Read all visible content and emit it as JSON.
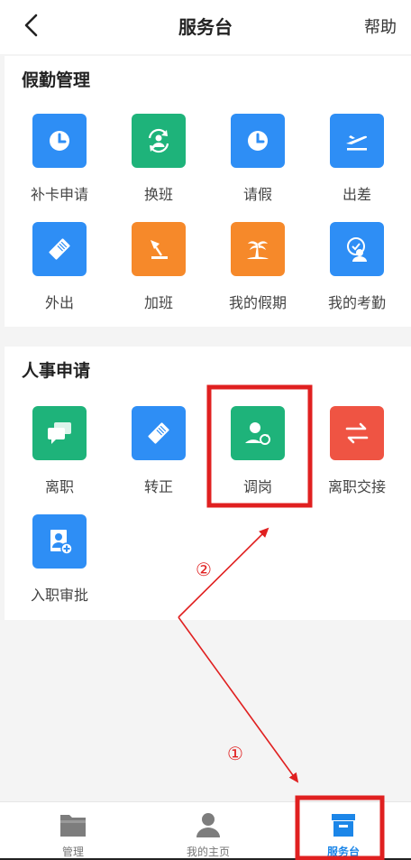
{
  "header": {
    "title": "服务台",
    "help_label": "帮助"
  },
  "leave_section": {
    "title": "假勤管理",
    "items": [
      {
        "label": "补卡申请",
        "icon": "clock-icon",
        "color": "#2e8ef5"
      },
      {
        "label": "换班",
        "icon": "swap-shift-icon",
        "color": "#1eb37a"
      },
      {
        "label": "请假",
        "icon": "clock-icon",
        "color": "#2e8ef5"
      },
      {
        "label": "出差",
        "icon": "airplane-icon",
        "color": "#2e8ef5"
      },
      {
        "label": "外出",
        "icon": "eraser-icon",
        "color": "#2e8ef5"
      },
      {
        "label": "加班",
        "icon": "desk-lamp-icon",
        "color": "#f6892a"
      },
      {
        "label": "我的假期",
        "icon": "palm-tree-icon",
        "color": "#f6892a"
      },
      {
        "label": "我的考勤",
        "icon": "user-check-icon",
        "color": "#2e8ef5"
      }
    ]
  },
  "hr_section": {
    "title": "人事申请",
    "items": [
      {
        "label": "离职",
        "icon": "chat-bubbles-icon",
        "color": "#1eb37a"
      },
      {
        "label": "转正",
        "icon": "eraser-icon",
        "color": "#2e8ef5"
      },
      {
        "label": "调岗",
        "icon": "user-transfer-icon",
        "color": "#1eb37a"
      },
      {
        "label": "离职交接",
        "icon": "exchange-arrows-icon",
        "color": "#ef5443"
      },
      {
        "label": "入职审批",
        "icon": "user-add-icon",
        "color": "#2e8ef5"
      }
    ]
  },
  "annotations": {
    "step1": "①",
    "step2": "②",
    "color": "#e02020"
  },
  "tabbar": {
    "tabs": [
      {
        "label": "管理",
        "icon": "folder-icon"
      },
      {
        "label": "我的主页",
        "icon": "person-icon"
      },
      {
        "label": "服务台",
        "icon": "archive-box-icon",
        "active": true
      }
    ],
    "active_color": "#1c86e8"
  }
}
